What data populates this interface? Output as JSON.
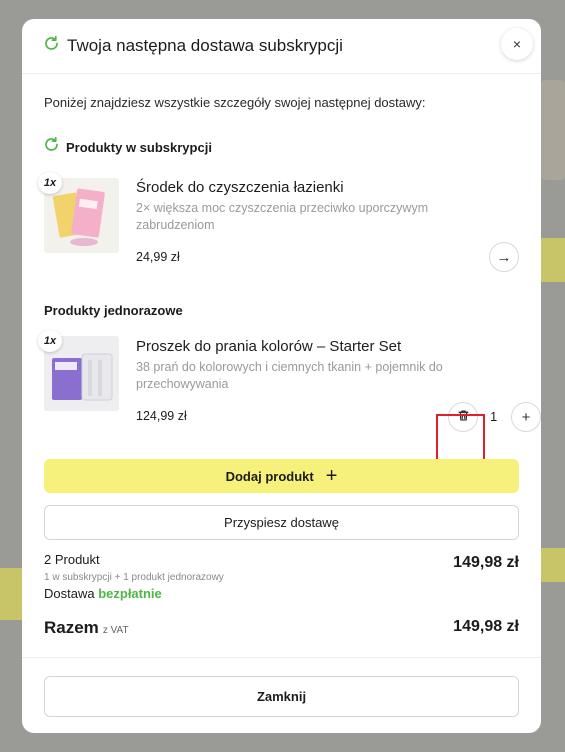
{
  "header": {
    "title": "Twoja następna dostawa subskrypcji",
    "close_icon": "×"
  },
  "intro": "Poniżej znajdziesz wszystkie szczegóły swojej następnej dostawy:",
  "subscription_section": {
    "label": "Produkty w subskrypcji"
  },
  "subscription_product": {
    "qty": "1x",
    "name": "Środek do czyszczenia łazienki",
    "description": "2× większa moc czyszczenia przeciwko uporczywym zabrudzeniom",
    "price": "24,99 zł",
    "arrow": "→"
  },
  "onetime_section": {
    "label": "Produkty jednorazowe"
  },
  "onetime_product": {
    "qty": "1x",
    "name": "Proszek do prania kolorów – Starter Set",
    "description": "38 prań do kolorowych i ciemnych tkanin + pojemnik do przechowywania",
    "price": "124,99 zł",
    "quantity": "1",
    "plus": "+"
  },
  "buttons": {
    "add_product": "Dodaj produkt",
    "add_plus": "+",
    "speed_delivery": "Przyspiesz dostawę",
    "close": "Zamknij"
  },
  "summary": {
    "count": "2 Produkt",
    "breakdown": "1 w subskrypcji + 1 produkt jednorazowy",
    "subtotal": "149,98 zł",
    "delivery_label": "Dostawa",
    "delivery_value": "bezpłatnie",
    "total_label": "Razem",
    "vat_note": "z VAT",
    "total": "149,98 zł"
  },
  "colors": {
    "accent_yellow": "#f6f17a",
    "green": "#4fb548",
    "highlight_red": "#e0212a"
  }
}
